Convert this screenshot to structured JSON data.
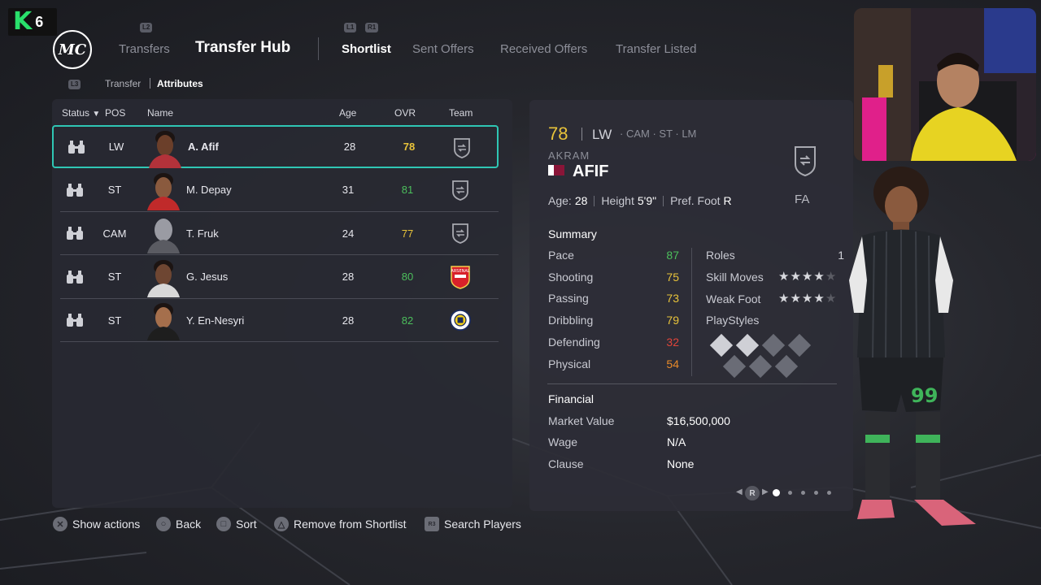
{
  "badge": {
    "letter": "K",
    "number": "6"
  },
  "logo": {
    "text": "MC"
  },
  "hints": {
    "l2": "L2",
    "l1": "L1",
    "r1": "R1",
    "l3": "L3",
    "r3": "R3",
    "r": "R"
  },
  "nav": {
    "transfers": "Transfers",
    "title": "Transfer Hub",
    "tabs": [
      {
        "label": "Shortlist",
        "active": true
      },
      {
        "label": "Sent Offers",
        "active": false
      },
      {
        "label": "Received Offers",
        "active": false
      },
      {
        "label": "Transfer Listed",
        "active": false
      }
    ]
  },
  "breadcrumb": {
    "first": "Transfer",
    "second": "Attributes"
  },
  "table": {
    "headers": {
      "status": "Status",
      "pos": "POS",
      "name": "Name",
      "age": "Age",
      "ovr": "OVR",
      "team": "Team"
    },
    "rows": [
      {
        "pos": "LW",
        "name": "A. Afif",
        "age": "28",
        "ovr": "78",
        "ovr_color": "#e8c33a",
        "team": "shield"
      },
      {
        "pos": "ST",
        "name": "M. Depay",
        "age": "31",
        "ovr": "81",
        "ovr_color": "#4cbf5c",
        "team": "shield"
      },
      {
        "pos": "CAM",
        "name": "T. Fruk",
        "age": "24",
        "ovr": "77",
        "ovr_color": "#e8c33a",
        "team": "shield"
      },
      {
        "pos": "ST",
        "name": "G. Jesus",
        "age": "28",
        "ovr": "80",
        "ovr_color": "#4cbf5c",
        "team": "arsenal"
      },
      {
        "pos": "ST",
        "name": "Y. En-Nesyri",
        "age": "28",
        "ovr": "82",
        "ovr_color": "#4cbf5c",
        "team": "fenerbahce"
      }
    ]
  },
  "player": {
    "ovr": "78",
    "position": "LW",
    "alt_positions": "CAM · ST · LM",
    "first_name": "AKRAM",
    "last_name": "AFIF",
    "age_label": "Age:",
    "age": "28",
    "height_label": "Height",
    "height": "5'9\"",
    "foot_label": "Pref. Foot",
    "foot": "R",
    "club": "FA",
    "summary_title": "Summary",
    "attributes": [
      {
        "label": "Pace",
        "value": "87",
        "color": "#4cbf5c"
      },
      {
        "label": "Shooting",
        "value": "75",
        "color": "#e8c33a"
      },
      {
        "label": "Passing",
        "value": "73",
        "color": "#e8c33a"
      },
      {
        "label": "Dribbling",
        "value": "79",
        "color": "#e8c33a"
      },
      {
        "label": "Defending",
        "value": "32",
        "color": "#e0453a"
      },
      {
        "label": "Physical",
        "value": "54",
        "color": "#e88a2a"
      }
    ],
    "roles_label": "Roles",
    "roles_value": "1",
    "skill_moves_label": "Skill Moves",
    "skill_moves_stars": 4,
    "weak_foot_label": "Weak Foot",
    "weak_foot_stars": 4,
    "playstyles_label": "PlayStyles",
    "financial_title": "Financial",
    "market_value_label": "Market Value",
    "market_value": "$16,500,000",
    "wage_label": "Wage",
    "wage": "N/A",
    "clause_label": "Clause",
    "clause": "None"
  },
  "footer": {
    "show_actions": "Show actions",
    "back": "Back",
    "sort": "Sort",
    "remove": "Remove from Shortlist",
    "search": "Search Players"
  },
  "colors": {
    "accent": "#2fc6b4",
    "gold": "#e8c33a",
    "green": "#4cbf5c",
    "red": "#e0453a"
  },
  "kit_number": "99"
}
